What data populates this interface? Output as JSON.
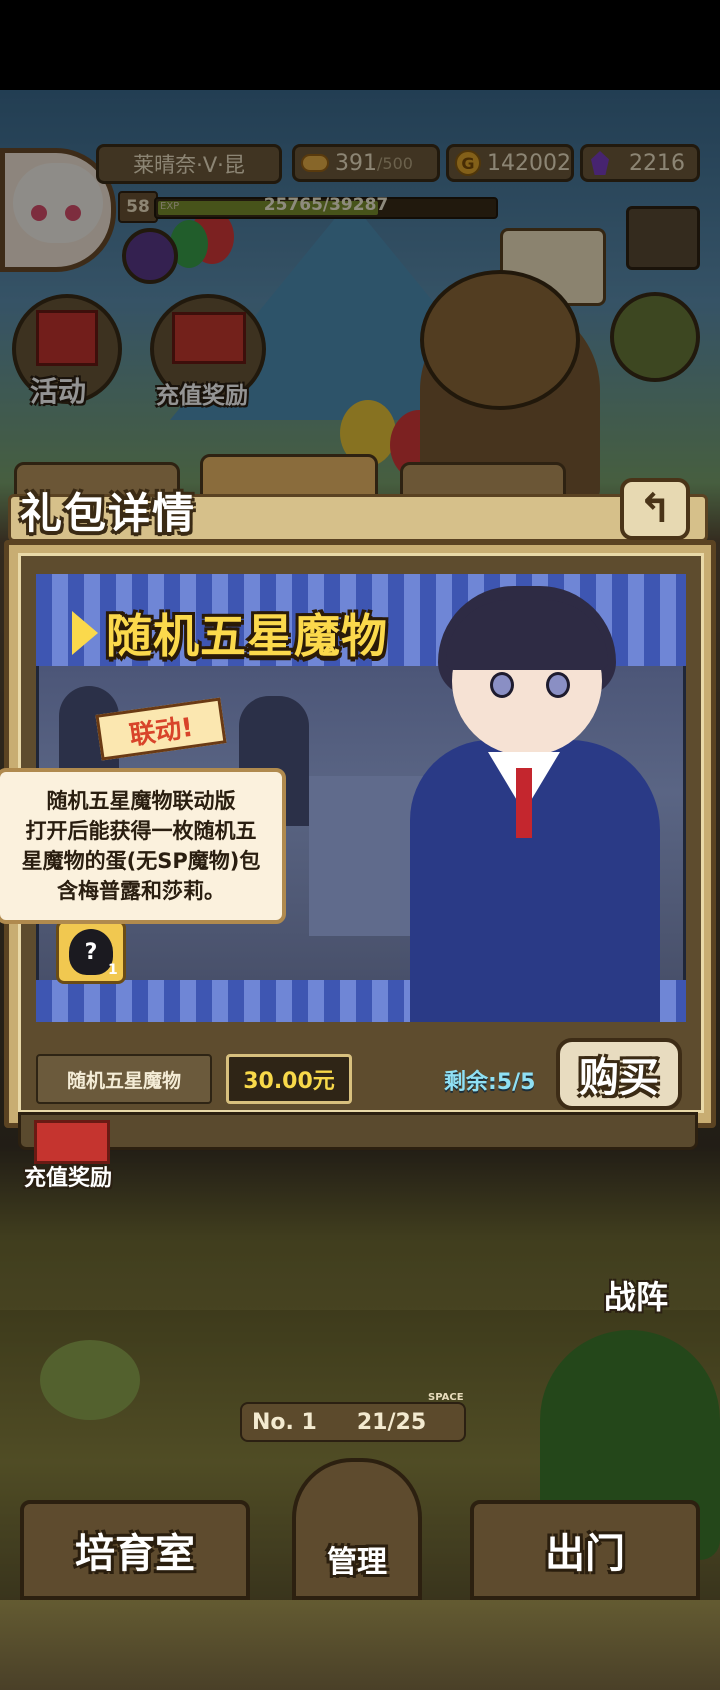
{
  "hud": {
    "player_name": "莱晴奈·V·昆",
    "level": "58",
    "exp_tag": "EXP",
    "exp_text": "25765/39287",
    "exp_progress": 0.656,
    "stamina_value": "391",
    "stamina_max": "/500",
    "gold_value": "142002",
    "gold_symbol": "G",
    "gem_value": "2216"
  },
  "side_menu": {
    "activity_label": "活动",
    "recharge_reward_label": "充值奖励"
  },
  "dialog": {
    "title": "礼包详情",
    "back_symbol": "↰",
    "banner_title": "随机五星魔物",
    "collab_badge": "联动!",
    "tooltip_text": "随机五星魔物联动版\n打开后能获得一枚随机五\n星魔物的蛋(无SP魔物)包\n含梅普露和莎莉。",
    "egg_symbol": "?",
    "egg_count": "1",
    "item_name": "随机五星魔物",
    "price": "30.00元",
    "remaining": "剩余:5/5",
    "buy_label": "购买"
  },
  "bottom": {
    "recharge_reward_label": "充值奖励",
    "formation_label": "战阵",
    "room_no": "No. 1",
    "space_label": "SPACE",
    "capacity": "21/25",
    "nursery_label": "培育室",
    "manage_label": "管理",
    "exit_label": "出门"
  },
  "colors": {
    "accent_yellow": "#fbd94c",
    "remaining_cyan": "#8fe0f4",
    "panel_brown": "#5e4c2e"
  },
  "icons": [
    "bread-icon",
    "gold-coin-icon",
    "gem-icon",
    "add-gem-icon",
    "gift-icon",
    "treasure-chest-icon",
    "crossed-swords-icon",
    "scroll-icon",
    "mail-icon",
    "backpack-icon",
    "back-arrow-icon",
    "egg-icon"
  ]
}
